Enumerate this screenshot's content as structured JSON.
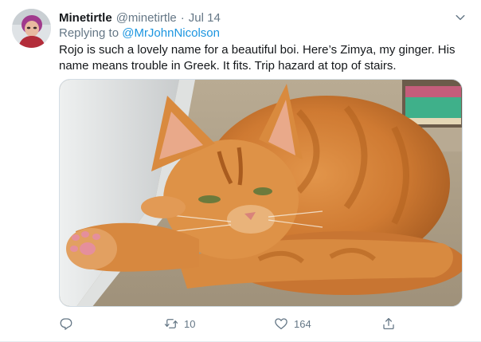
{
  "tweet": {
    "author": {
      "display_name": "Minetirtle",
      "handle": "@minetirtle",
      "avatar_icon": "profile-photo"
    },
    "separator": "·",
    "date": "Jul 14",
    "reply": {
      "prefix": "Replying to",
      "mention": "@MrJohnNicolson"
    },
    "text": "Rojo is such a lovely name for a beautiful boi. Here’s Zimya, my ginger. His name means trouble in Greek. It fits. Trip hazard at top of stairs.",
    "media": {
      "description_icon": "photo"
    },
    "actions": {
      "reply": {
        "icon": "reply-icon",
        "count": ""
      },
      "retweet": {
        "icon": "retweet-icon",
        "count": "10"
      },
      "like": {
        "icon": "heart-icon",
        "count": "164"
      },
      "share": {
        "icon": "share-icon",
        "count": ""
      }
    }
  },
  "colors": {
    "text_primary": "#14171a",
    "text_secondary": "#657786",
    "link": "#1b95e0",
    "border": "#e6ecf0"
  }
}
